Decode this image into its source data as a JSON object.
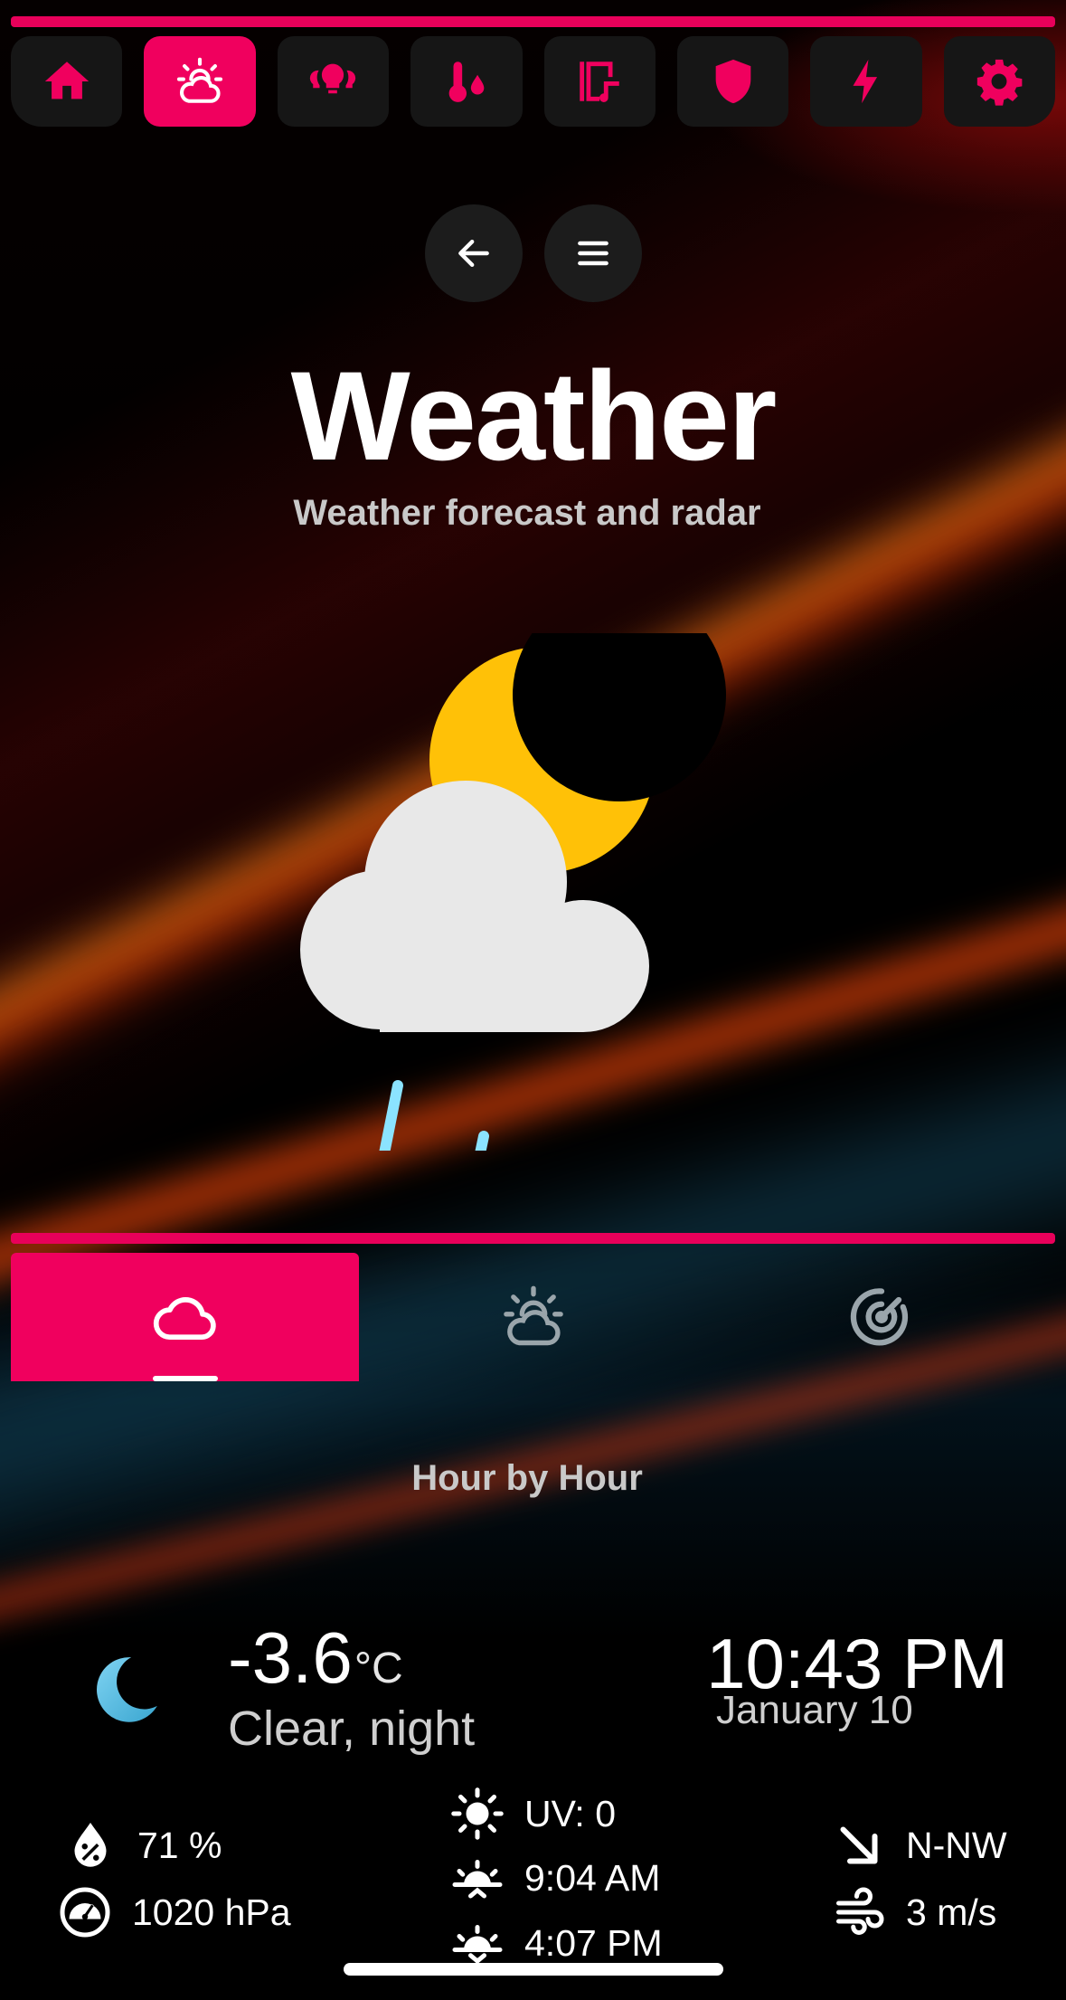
{
  "colors": {
    "accent": "#f0005e",
    "nav_bg": "#161616",
    "moon": "#ffc107",
    "cloud": "#e8e8e8",
    "rain": "#8be3ff"
  },
  "top_nav": [
    {
      "icon": "home-icon"
    },
    {
      "icon": "weather-partly-cloudy-icon",
      "active": true
    },
    {
      "icon": "lightbulb-group-icon"
    },
    {
      "icon": "thermometer-water-icon"
    },
    {
      "icon": "multimedia-icon"
    },
    {
      "icon": "shield-icon"
    },
    {
      "icon": "lightning-bolt-icon"
    },
    {
      "icon": "settings-gear-icon"
    }
  ],
  "header": {
    "back_icon": "arrow-left-icon",
    "menu_icon": "hamburger-menu-icon",
    "title": "Weather",
    "subtitle": "Weather forecast and radar"
  },
  "hero_icon": "night-partly-cloudy-rain-icon",
  "tabs": [
    {
      "icon": "cloud-outline-icon",
      "active": true
    },
    {
      "icon": "weather-partly-cloudy-icon"
    },
    {
      "icon": "radar-icon"
    }
  ],
  "section": {
    "label": "Hour by Hour"
  },
  "current": {
    "icon": "moon-crescent-icon",
    "temperature": "-3.6",
    "unit": "°C",
    "condition": "Clear, night",
    "time": "10:43 PM",
    "date": "January 10"
  },
  "stats": {
    "humidity": "71 %",
    "pressure": "1020 hPa",
    "uv": "UV: 0",
    "sunrise": "9:04 AM",
    "sunset": "4:07 PM",
    "wind_dir": "N-NW",
    "wind_speed": "3 m/s"
  }
}
